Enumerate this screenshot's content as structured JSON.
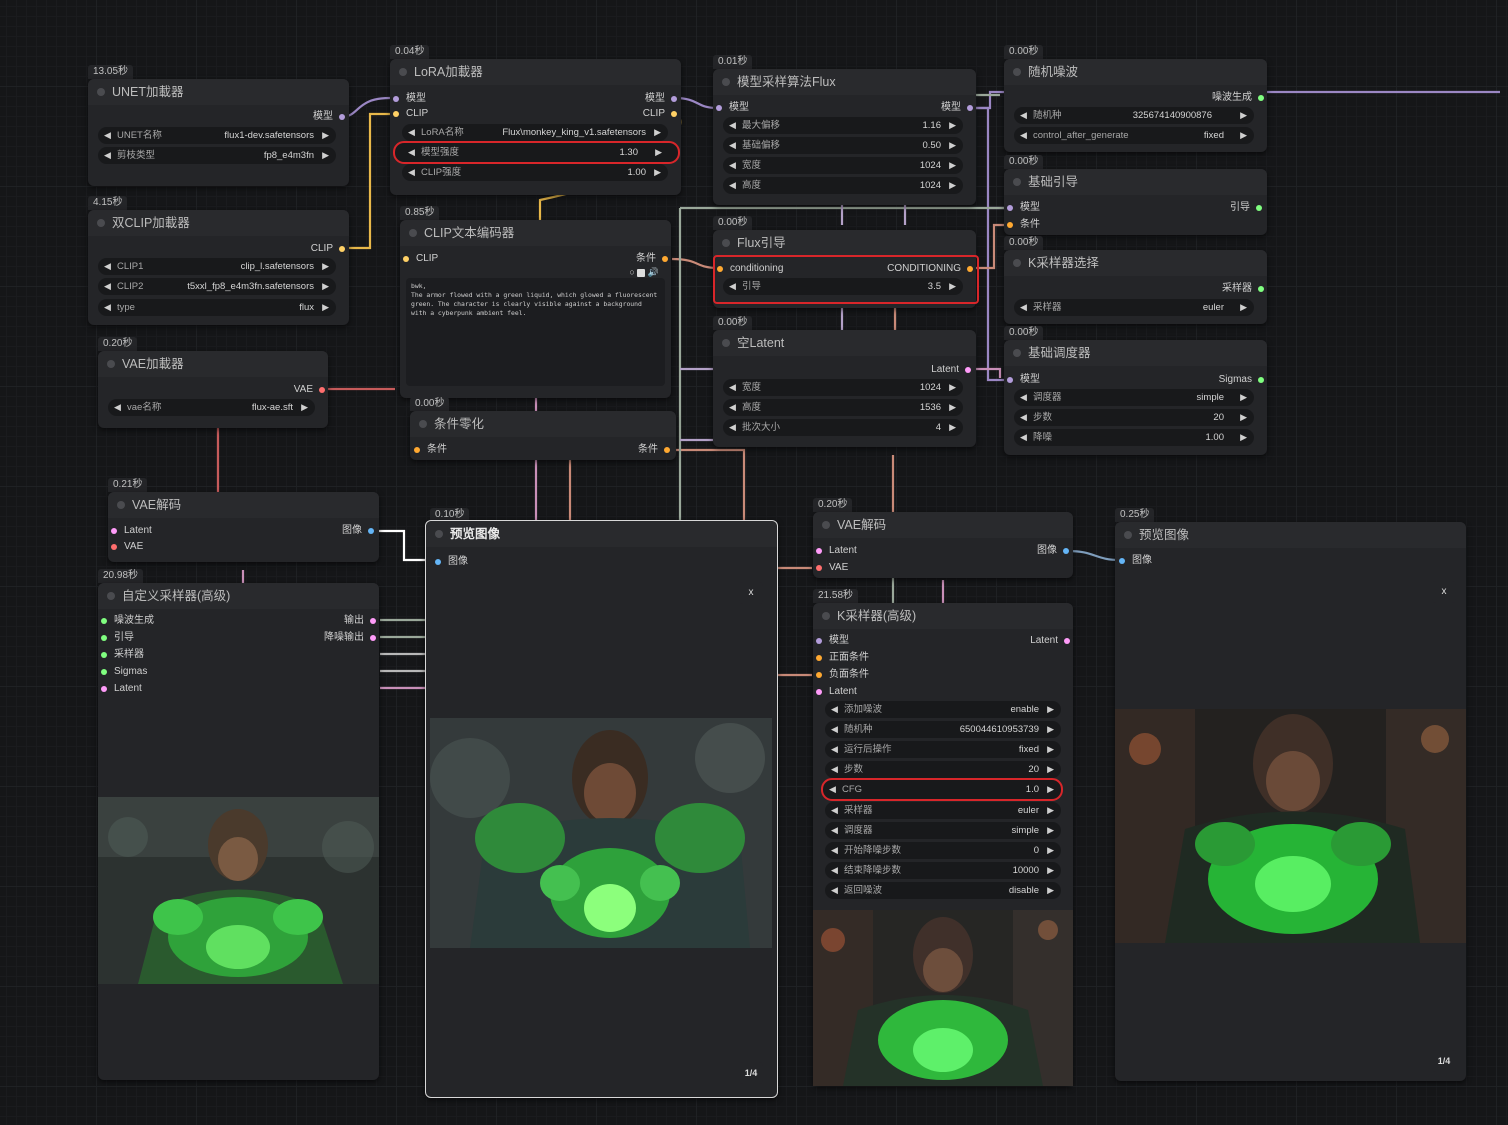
{
  "colors": {
    "model": "#b39ddb",
    "clip": "#ffd166",
    "vae": "#ff6e6e",
    "latent": "#ff9cf9",
    "image": "#64b5f6",
    "cond": "#ffa931",
    "noise": "#80ff80",
    "highlight": "#d8262a"
  },
  "unet": {
    "time": "13.05秒",
    "title": "UNET加載器",
    "out_model": "模型",
    "w1_label": "UNET名称",
    "w1_value": "flux1-dev.safetensors",
    "w2_label": "剪枝类型",
    "w2_value": "fp8_e4m3fn"
  },
  "dualclip": {
    "time": "4.15秒",
    "title": "双CLIP加載器",
    "out_clip": "CLIP",
    "w1_label": "CLIP1",
    "w1_value": "clip_l.safetensors",
    "w2_label": "CLIP2",
    "w2_value": "t5xxl_fp8_e4m3fn.safetensors",
    "w3_label": "type",
    "w3_value": "flux"
  },
  "vaeloader": {
    "time": "0.20秒",
    "title": "VAE加載器",
    "out_vae": "VAE",
    "w1_label": "vae名称",
    "w1_value": "flux-ae.sft"
  },
  "lora": {
    "time": "0.04秒",
    "title": "LoRA加載器",
    "in_model": "模型",
    "in_clip": "CLIP",
    "out_model": "模型",
    "out_clip": "CLIP",
    "w1_label": "LoRA名称",
    "w1_value": "Flux\\monkey_king_v1.safetensors",
    "w2_label": "模型强度",
    "w2_value": "1.30",
    "w3_label": "CLIP强度",
    "w3_value": "1.00"
  },
  "clipenc": {
    "time": "0.85秒",
    "title": "CLIP文本编码器",
    "in_clip": "CLIP",
    "out_cond": "条件",
    "prompt": "bwk,\nThe armor flowed with a green liquid, which glowed a fluorescent green. The character is clearly visible against a background with a cyberpunk ambient feel."
  },
  "zero": {
    "time": "0.00秒",
    "title": "条件零化",
    "in_cond": "条件",
    "out_cond": "条件"
  },
  "sampling": {
    "time": "0.01秒",
    "title": "模型采样算法Flux",
    "in_model": "模型",
    "out_model": "模型",
    "w1_label": "最大偏移",
    "w1_value": "1.16",
    "w2_label": "基础偏移",
    "w2_value": "0.50",
    "w3_label": "宽度",
    "w3_value": "1024",
    "w4_label": "高度",
    "w4_value": "1024"
  },
  "fluxguide": {
    "time": "0.00秒",
    "title": "Flux引导",
    "in_cond": "conditioning",
    "out_cond": "CONDITIONING",
    "w1_label": "引导",
    "w1_value": "3.5"
  },
  "latent": {
    "time": "0.00秒",
    "title": "空Latent",
    "out_latent": "Latent",
    "w1_label": "宽度",
    "w1_value": "1024",
    "w2_label": "高度",
    "w2_value": "1536",
    "w3_label": "批次大小",
    "w3_value": "4"
  },
  "noise": {
    "time": "0.00秒",
    "title": "随机噪波",
    "out": "噪波生成",
    "w1_label": "随机种",
    "w1_value": "325674140900876",
    "w2_label": "control_after_generate",
    "w2_value": "fixed"
  },
  "guider": {
    "time": "0.00秒",
    "title": "基础引导",
    "in_model": "模型",
    "in_cond": "条件",
    "out": "引导"
  },
  "ksel": {
    "time": "0.00秒",
    "title": "K采样器选择",
    "out": "采样器",
    "w1_label": "采样器",
    "w1_value": "euler"
  },
  "sched": {
    "time": "0.00秒",
    "title": "基础调度器",
    "in_model": "模型",
    "out": "Sigmas",
    "w1_label": "调度器",
    "w1_value": "simple",
    "w2_label": "步数",
    "w2_value": "20",
    "w3_label": "降噪",
    "w3_value": "1.00"
  },
  "vaedec1": {
    "time": "0.21秒",
    "title": "VAE解码",
    "in_latent": "Latent",
    "in_vae": "VAE",
    "out": "图像"
  },
  "custom": {
    "time": "20.98秒",
    "title": "自定义采样器(高级)",
    "in1": "噪波生成",
    "in2": "引导",
    "in3": "采样器",
    "in4": "Sigmas",
    "in5": "Latent",
    "out1": "输出",
    "out2": "降噪输出"
  },
  "preview1": {
    "time": "0.10秒",
    "title": "预览图像",
    "in": "图像",
    "close": "x",
    "pager": "1/4"
  },
  "vaedec2": {
    "time": "0.20秒",
    "title": "VAE解码",
    "in_latent": "Latent",
    "in_vae": "VAE",
    "out": "图像"
  },
  "ksadv": {
    "time": "21.58秒",
    "title": "K采样器(高级)",
    "in1": "模型",
    "in2": "正面条件",
    "in3": "负面条件",
    "in4": "Latent",
    "out": "Latent",
    "w1_label": "添加噪波",
    "w1_value": "enable",
    "w2_label": "随机种",
    "w2_value": "650044610953739",
    "w3_label": "运行后操作",
    "w3_value": "fixed",
    "w4_label": "步数",
    "w4_value": "20",
    "w5_label": "CFG",
    "w5_value": "1.0",
    "w6_label": "采样器",
    "w6_value": "euler",
    "w7_label": "调度器",
    "w7_value": "simple",
    "w8_label": "开始降噪步数",
    "w8_value": "0",
    "w9_label": "结束降噪步数",
    "w9_value": "10000",
    "w10_label": "返回噪波",
    "w10_value": "disable"
  },
  "preview2": {
    "time": "0.25秒",
    "title": "预览图像",
    "in": "图像",
    "close": "x",
    "pager": "1/4"
  }
}
